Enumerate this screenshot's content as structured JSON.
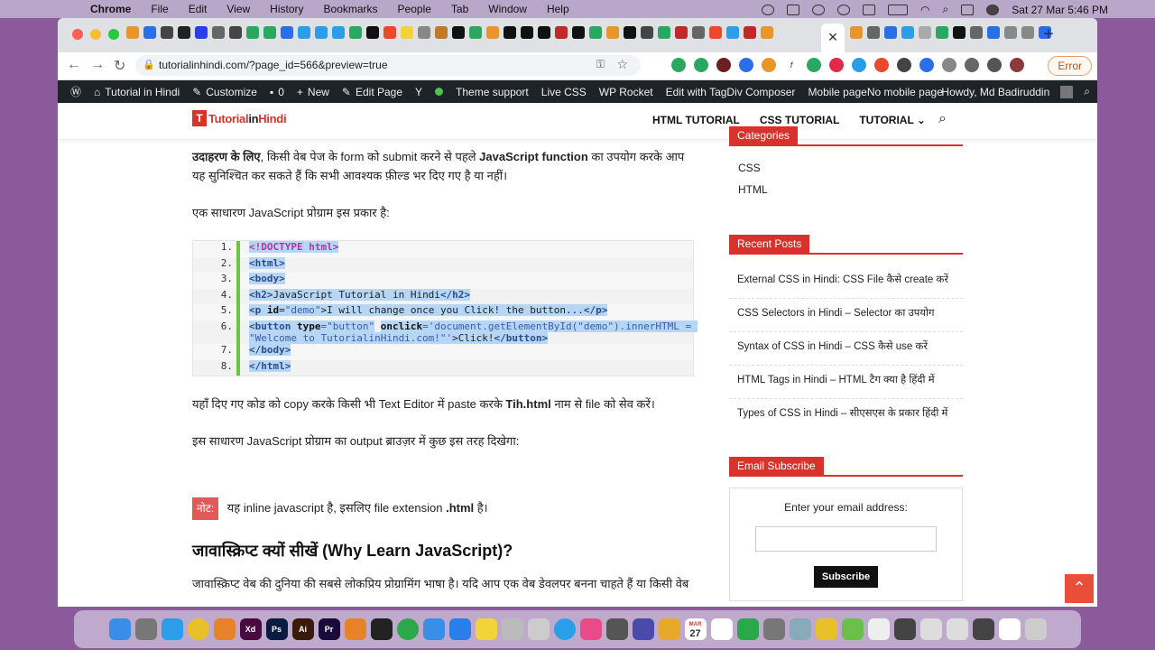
{
  "menubar": {
    "app": "Chrome",
    "menus": [
      "File",
      "Edit",
      "View",
      "History",
      "Bookmarks",
      "People",
      "Tab",
      "Window",
      "Help"
    ],
    "datetime": "Sat 27 Mar  5:46 PM"
  },
  "browser": {
    "url": "tutorialinhindi.com/?page_id=566&preview=true",
    "error_label": "Error",
    "colors": {
      "tab_strip": "#dfe1e5",
      "accent": "#d9322c"
    }
  },
  "wp_admin": {
    "site": "Tutorial in Hindi",
    "customize": "Customize",
    "comments": "0",
    "new": "New",
    "edit": "Edit Page",
    "theme_support": "Theme support",
    "live_css": "Live CSS",
    "wp_rocket": "WP Rocket",
    "tagdiv": "Edit with TagDiv Composer",
    "mobile": "Mobile pageNo mobile page",
    "howdy": "Howdy, Md Badiruddin"
  },
  "site": {
    "logo_red": "Tutorial",
    "logo_dark": "in",
    "logo_red2": "Hindi",
    "nav": [
      "HTML TUTORIAL",
      "CSS TUTORIAL",
      "TUTORIAL"
    ]
  },
  "article": {
    "p1_bold": "उदाहरण के लिए",
    "p1_a": ", किसी वेब पेज के form को submit करने से पहले ",
    "p1_b": "JavaScript function",
    "p1_c": " का उपयोग करके आप यह सुनिश्चित कर सकते हैं कि सभी आवश्यक फ़ील्ड भर दिए गए है या नहीं।",
    "p2": "एक साधारण JavaScript प्रोग्राम इस प्रकार है:",
    "code_line_numbers": [
      "1.",
      "2.",
      "3.",
      "4.",
      "5.",
      "6.",
      "7.",
      "8."
    ],
    "code": {
      "l1": "<!DOCTYPE html>",
      "l2": "<html>",
      "l3": "<body>",
      "l4_open": "<h2>",
      "l4_text": "JavaScript Tutorial in Hindi",
      "l4_close": "</h2>",
      "l5_open": "<p ",
      "l5_attr": "id",
      "l5_eq": "=",
      "l5_val": "\"demo\"",
      "l5_text": ">I will change once you Click! the button...",
      "l5_close": "</p>",
      "l6_open": "<button ",
      "l6_attr1": "type",
      "l6_val1": "=\"button\"",
      "l6_attr2": "onclick",
      "l6_val2": "='document.getElementById(\"demo\").innerHTML = \"Welcome to TutorialinHindi.com!\"'",
      "l6_text": ">Click!",
      "l6_close": "</button>",
      "l7": "</body>",
      "l8": "</html>"
    },
    "p3_a": "यहाँ दिए गए कोड को copy करके किसी भी Text Editor में paste करके ",
    "p3_b": "Tih.html",
    "p3_c": " नाम से file को सेव करें।",
    "p4": "इस साधारण JavaScript प्रोग्राम का output ब्राउज़र में कुछ इस तरह दिखेगा:",
    "note_label": "नोट:",
    "note_a": " यह inline javascript है, इसलिए file extension ",
    "note_b": ".html",
    "note_c": " है।",
    "h2": "जावास्क्रिप्ट क्यों सीखें (Why Learn JavaScript)?",
    "p5": "जावास्क्रिप्ट वेब की दुनिया की सबसे लोकप्रिय प्रोग्रामिंग भाषा है। यदि आप एक वेब डेवलपर बनना चाहते हैं या किसी वेब"
  },
  "sidebar": {
    "categories_title": "Categories",
    "categories": [
      "CSS",
      "HTML"
    ],
    "recent_title": "Recent Posts",
    "recent": [
      "External CSS in Hindi: CSS File कैसे create करें",
      "CSS Selectors in Hindi – Selector का उपयोग",
      "Syntax of CSS in Hindi – CSS कैसे use करें",
      "HTML Tags in Hindi – HTML टैग क्या है हिंदी में",
      "Types of CSS in Hindi – सीएसएस के प्रकार हिंदी में"
    ],
    "email_title": "Email Subscribe",
    "email_label": "Enter your email address:",
    "subscribe": "Subscribe"
  },
  "dock_calendar": {
    "month": "MAR",
    "day": "27"
  }
}
